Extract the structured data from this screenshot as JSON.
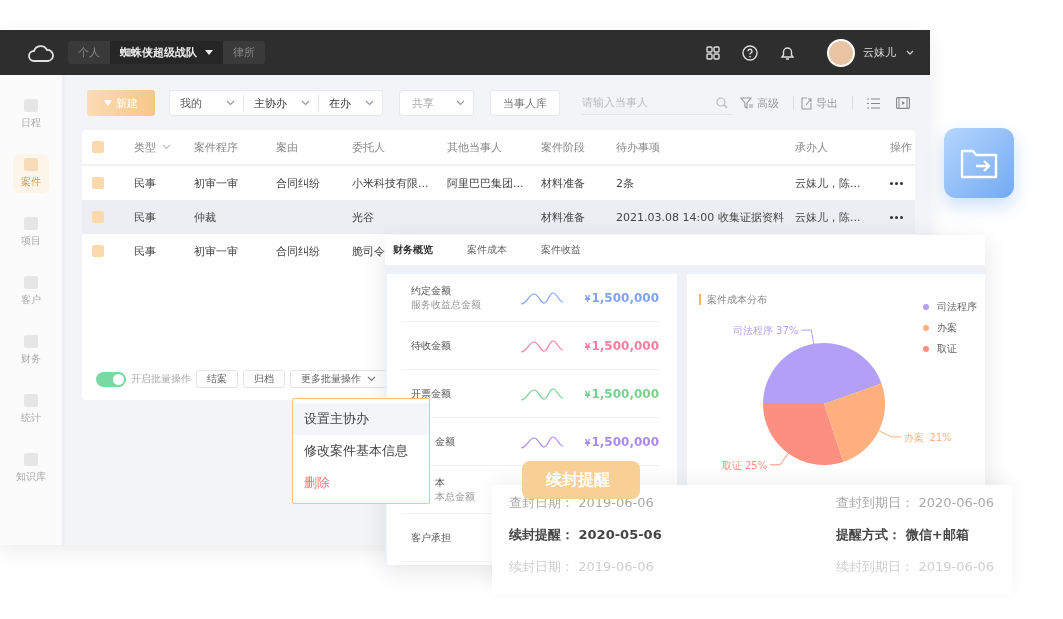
{
  "topbar": {
    "tabs": [
      {
        "label": "个人",
        "selected": false
      },
      {
        "label": "蜘蛛侠超级战队",
        "selected": true
      },
      {
        "label": "律所",
        "selected": false
      }
    ],
    "user": "云妹儿"
  },
  "sidebar": {
    "items": [
      {
        "label": "日程",
        "selected": false
      },
      {
        "label": "案件",
        "selected": true
      },
      {
        "label": "项目",
        "selected": false
      },
      {
        "label": "客户",
        "selected": false
      },
      {
        "label": "财务",
        "selected": false
      },
      {
        "label": "统计",
        "selected": false
      },
      {
        "label": "知识库",
        "selected": false
      }
    ]
  },
  "toolbar": {
    "new_button": "新建",
    "filters": [
      "我的",
      "主协办",
      "在办"
    ],
    "share": "共享",
    "party_library": "当事人库",
    "search": {
      "placeholder": "请输入当事人"
    },
    "advanced": "高级",
    "export": "导出"
  },
  "table": {
    "header_checked": true,
    "columns": [
      "类型",
      "案件程序",
      "案由",
      "委托人",
      "其他当事人",
      "案件阶段",
      "待办事项",
      "承办人",
      "操作"
    ],
    "rows": [
      {
        "checked": true,
        "selected": false,
        "cells": [
          "民事",
          "初审一审",
          "合同纠纷",
          "小米科技有限...",
          "阿里巴巴集团...",
          "材料准备",
          "2条",
          "云妹儿，陈..."
        ]
      },
      {
        "checked": true,
        "selected": true,
        "cells": [
          "民事",
          "仲裁",
          null,
          "光谷",
          null,
          "材料准备",
          "2021.03.08 14:00 收集证据资料",
          "云妹儿，陈..."
        ]
      },
      {
        "checked": true,
        "selected": false,
        "cells": [
          "民事",
          "初审一审",
          "合同纠纷",
          "脆司令"
        ]
      }
    ]
  },
  "batch": {
    "toggle": {
      "label": "开启批量操作",
      "on": true
    },
    "buttons": [
      "结案",
      "归档"
    ],
    "more": "更多批量操作"
  },
  "dropdown": {
    "items": [
      {
        "label": "设置主协办",
        "kind": "normal",
        "selected": true
      },
      {
        "label": "修改案件基本信息",
        "kind": "normal",
        "selected": false
      },
      {
        "label": "删除",
        "kind": "danger",
        "selected": false
      }
    ]
  },
  "finance": {
    "tabs": [
      {
        "label": "财务概览",
        "selected": true
      },
      {
        "label": "案件成本",
        "selected": false
      },
      {
        "label": "案件收益",
        "selected": false
      }
    ],
    "rows": [
      {
        "label": "约定金额",
        "sublabel": "服务收益总金额",
        "value": "1,500,000",
        "currency": "¥",
        "color": "#7fa3f0",
        "kind": "full"
      },
      {
        "label": "待收金额",
        "value": "1,500,000",
        "currency": "¥",
        "color": "#f47fa0",
        "kind": "full"
      },
      {
        "label": "开票金额",
        "value": "1,500,000",
        "currency": "¥",
        "color": "#79d08f",
        "kind": "full"
      },
      {
        "label": "金额",
        "value": "1,500,000",
        "currency": "¥",
        "color": "#a98bef",
        "kind": "covered"
      },
      {
        "label": "本",
        "sublabel": "本总金额",
        "kind": "covered"
      },
      {
        "label": "客户承担",
        "kind": "full"
      }
    ],
    "chart_title": "案件成本分布",
    "chart_data": {
      "type": "pie",
      "categories": [
        "司法程序",
        "办案",
        "取证"
      ],
      "values": [
        37,
        21,
        25
      ],
      "colors": [
        "#b39ff5",
        "#fdb07e",
        "#fb9080"
      ],
      "value_labels": [
        "37%",
        "21%",
        "25%"
      ]
    }
  },
  "seal_card": {
    "badge": "续封提醒",
    "fields": [
      {
        "label": "查封日期：",
        "value": "2019-06-06",
        "kind": "faded"
      },
      {
        "label": "查封到期日：",
        "value": "2020-06-06",
        "kind": "faded"
      },
      {
        "label": "续封提醒：",
        "value": "2020-05-06",
        "kind": "bold"
      },
      {
        "label": "提醒方式：",
        "value": "微信+邮箱",
        "kind": "bold"
      },
      {
        "label": "续封日期：",
        "value": "2019-06-06",
        "kind": "dim"
      },
      {
        "label": "续封到期日：",
        "value": "2019-06-06",
        "kind": "dim"
      }
    ]
  }
}
